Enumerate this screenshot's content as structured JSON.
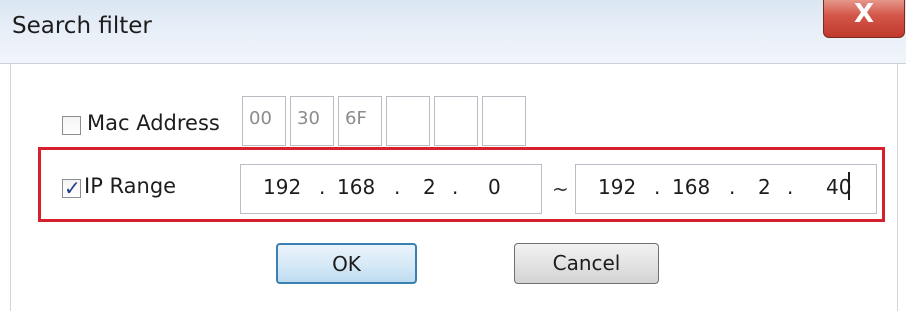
{
  "window": {
    "title": "Search filter",
    "close_glyph": "X"
  },
  "mac": {
    "label": "Mac Address",
    "checked": false,
    "octets": [
      "00",
      "30",
      "6F",
      "",
      "",
      ""
    ]
  },
  "ip": {
    "label": "IP Range",
    "checked": true,
    "check_glyph": "✓",
    "from": [
      "192",
      "168",
      "2",
      "0"
    ],
    "to": [
      "192",
      "168",
      "2",
      "40"
    ],
    "separator": "~",
    "dot": "."
  },
  "buttons": {
    "ok": "OK",
    "cancel": "Cancel"
  },
  "colors": {
    "highlight": "#d6202b",
    "close": "#c9473a"
  }
}
